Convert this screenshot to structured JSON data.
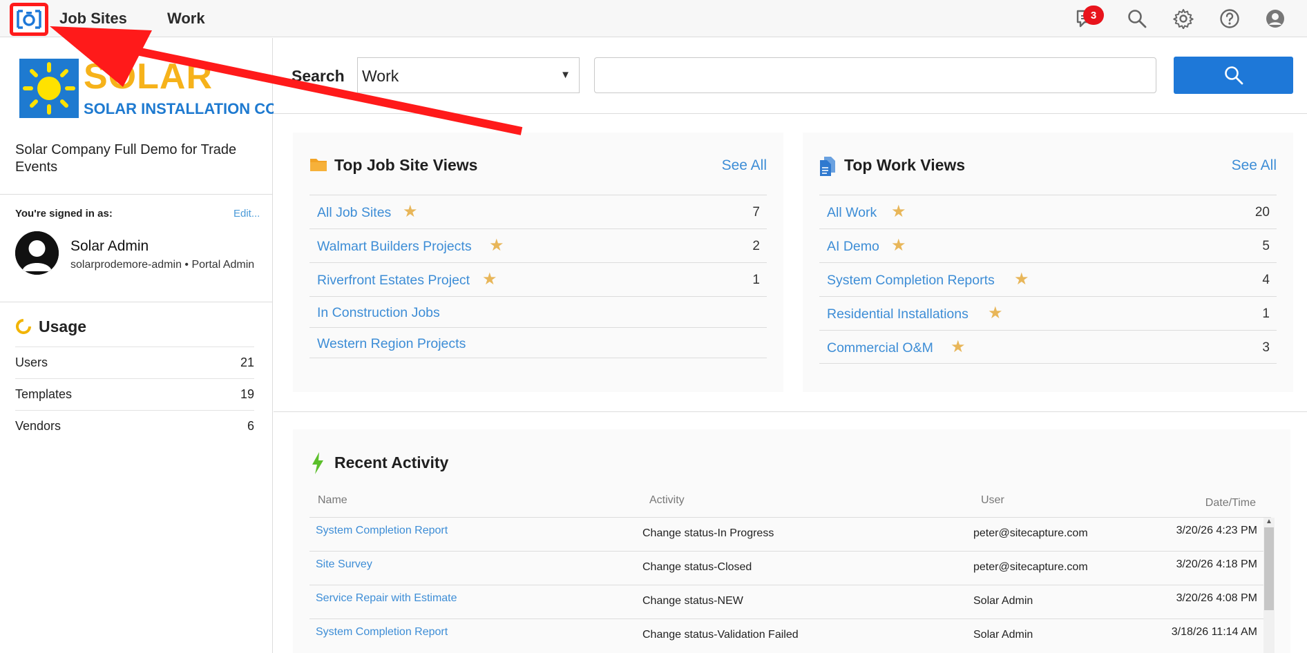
{
  "nav": {
    "items": [
      {
        "label": "Job Sites"
      },
      {
        "label": "Work"
      }
    ],
    "notification_count": "3"
  },
  "sidebar": {
    "brand_word": "SOLAR",
    "brand_sub": "SOLAR INSTALLATION CO.",
    "company_name": "Solar Company Full Demo for Trade Events",
    "signed_in_label": "You're signed in as:",
    "edit_label": "Edit...",
    "user_name": "Solar Admin",
    "user_role": "solarprodemore-admin • Portal Admin",
    "usage_title": "Usage",
    "usage": [
      {
        "label": "Users",
        "value": "21"
      },
      {
        "label": "Templates",
        "value": "19"
      },
      {
        "label": "Vendors",
        "value": "6"
      }
    ]
  },
  "search": {
    "label": "Search",
    "scope": "Work",
    "query": ""
  },
  "job_site_views": {
    "title": "Top Job Site Views",
    "see_all": "See All",
    "rows": [
      {
        "name": "All Job Sites",
        "count": "7",
        "starred": true
      },
      {
        "name": "Walmart Builders Projects",
        "count": "2",
        "starred": true
      },
      {
        "name": "Riverfront Estates Project",
        "count": "1",
        "starred": true
      },
      {
        "name": "In Construction Jobs",
        "count": "",
        "starred": false
      },
      {
        "name": "Western Region Projects",
        "count": "",
        "starred": false
      }
    ]
  },
  "work_views": {
    "title": "Top Work Views",
    "see_all": "See All",
    "rows": [
      {
        "name": "All Work",
        "count": "20",
        "starred": true
      },
      {
        "name": "AI Demo",
        "count": "5",
        "starred": true
      },
      {
        "name": "System Completion Reports",
        "count": "4",
        "starred": true
      },
      {
        "name": "Residential Installations",
        "count": "1",
        "starred": true
      },
      {
        "name": "Commercial O&M",
        "count": "3",
        "starred": true
      }
    ]
  },
  "activity": {
    "title": "Recent Activity",
    "columns": {
      "name": "Name",
      "activity": "Activity",
      "user": "User",
      "date": "Date/Time"
    },
    "rows": [
      {
        "name": "System Completion Report",
        "activity": "Change status-In Progress",
        "user": "peter@sitecapture.com",
        "date": "3/20/26 4:23 PM"
      },
      {
        "name": "Site Survey",
        "activity": "Change status-Closed",
        "user": "peter@sitecapture.com",
        "date": "3/20/26 4:18 PM"
      },
      {
        "name": "Service Repair with Estimate",
        "activity": "Change status-NEW",
        "user": "Solar Admin",
        "date": "3/20/26 4:08 PM"
      },
      {
        "name": "System Completion Report",
        "activity": "Change status-Validation Failed",
        "user": "Solar Admin",
        "date": "3/18/26 11:14 AM"
      }
    ]
  },
  "colors": {
    "accent": "#1e78d8",
    "link": "#3d8dd6",
    "star": "#e8b659",
    "annotation": "#ff1a1a"
  },
  "icons": [
    "app-logo-icon",
    "chat-icon",
    "search-icon",
    "gear-icon",
    "help-icon",
    "user-icon",
    "folder-icon",
    "document-icon",
    "lightning-icon",
    "usage-ring-icon"
  ]
}
